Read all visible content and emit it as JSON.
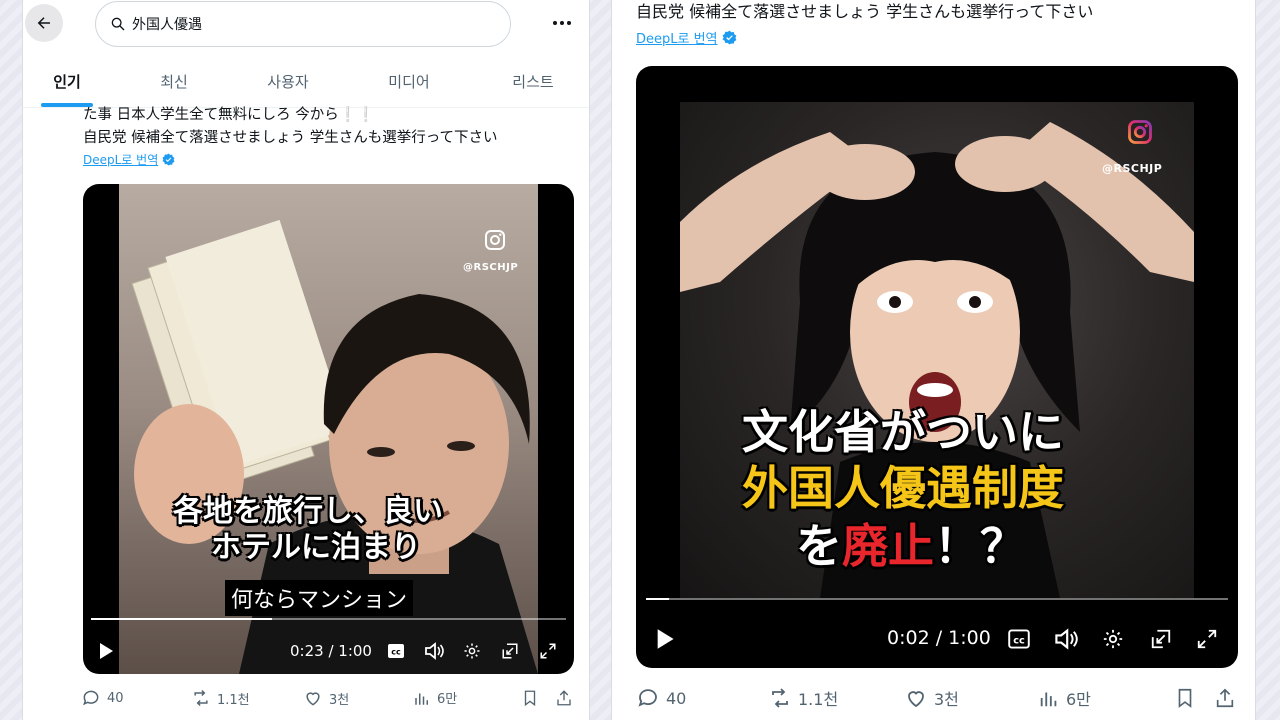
{
  "left": {
    "search": {
      "value": "外国人優遇"
    },
    "tabs": [
      {
        "label": "인기"
      },
      {
        "label": "최신"
      },
      {
        "label": "사용자"
      },
      {
        "label": "미디어"
      },
      {
        "label": "리스트"
      }
    ],
    "tweet_lines": [
      "た事 日本人学生全て無料にしろ 今から❕❕",
      "自民党 候補全て落選させましょう 学生さんも選挙行って下さい"
    ],
    "translate_label": "DeepL로 번역",
    "video": {
      "ig_handle": "@RSCHJP",
      "caption_line1": "各地を旅行し、良い",
      "caption_line2": "ホテルに泊まり",
      "subtitle": "何ならマンション",
      "time": "0:23 / 1:00",
      "progress": 0.38
    },
    "actions": {
      "replies": "40",
      "reposts": "1.1천",
      "likes": "3천",
      "views": "6만"
    }
  },
  "right": {
    "tweet_line": "自民党 候補全て落選させましょう 学生さんも選挙行って下さい",
    "translate_label": "DeepL로 번역",
    "video": {
      "ig_handle": "@RSCHJP",
      "headline_line1": "文化省がついに",
      "headline_line2": "外国人優遇制度",
      "headline_line3_a": "を",
      "headline_line3_b": "廃止",
      "headline_line3_c": "！？",
      "time": "0:02 / 1:00",
      "progress": 0.04
    },
    "actions": {
      "replies": "40",
      "reposts": "1.1천",
      "likes": "3천",
      "views": "6만"
    }
  },
  "colors": {
    "accent": "#1d9bf0",
    "headline_yellow": "#f5c518",
    "headline_red": "#e8262b"
  }
}
